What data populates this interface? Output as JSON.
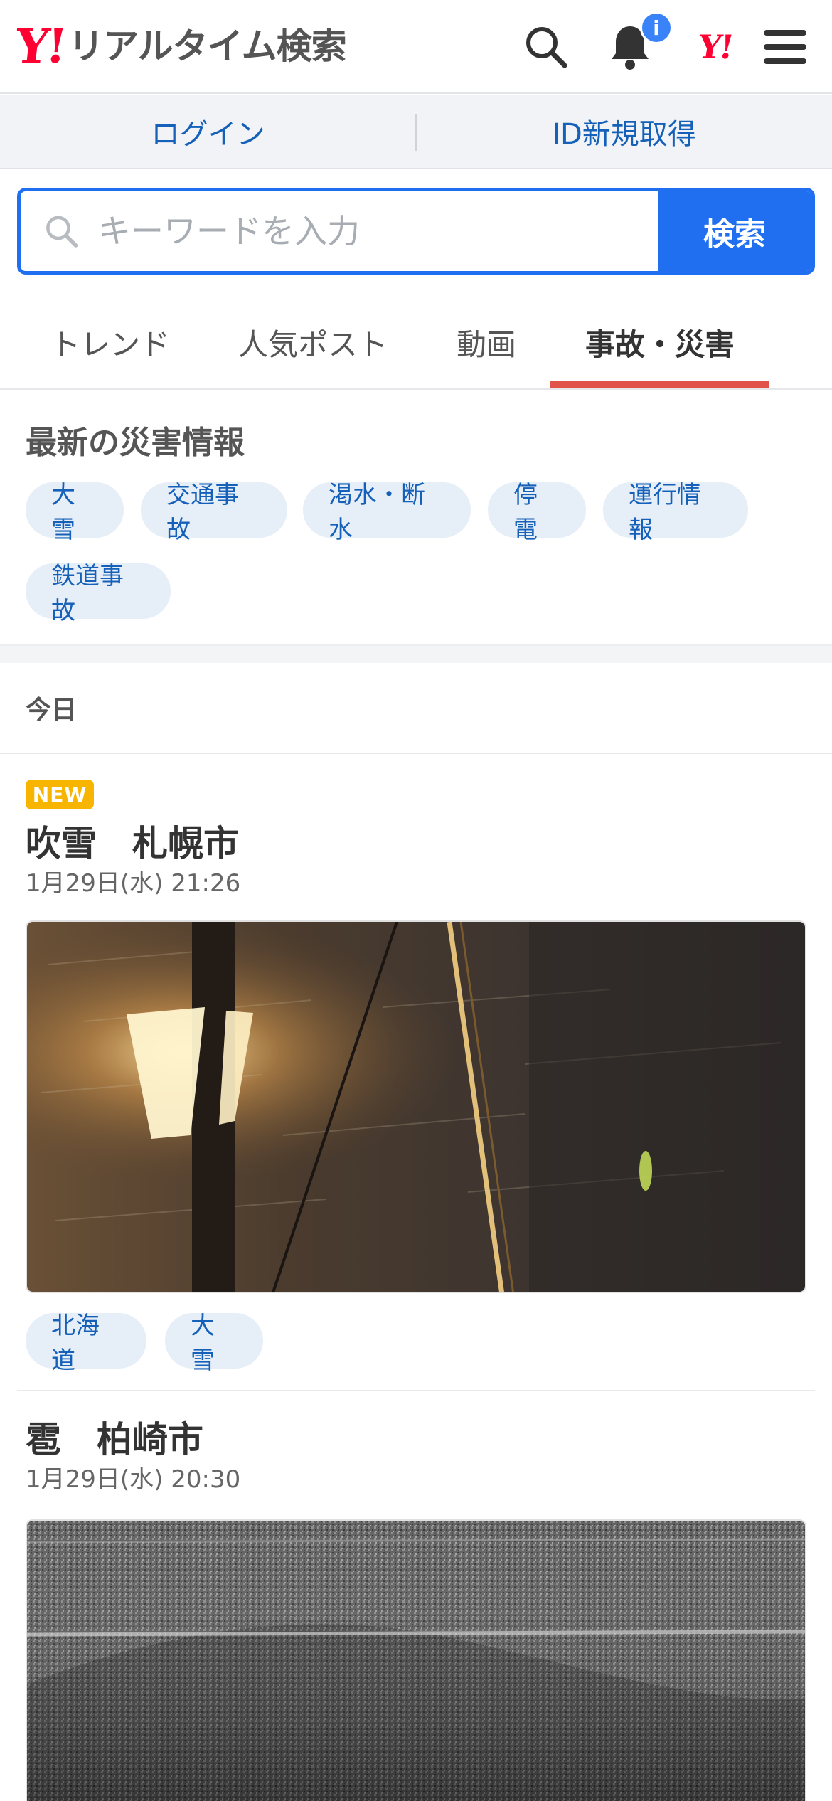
{
  "header": {
    "logo_mark": "Y!",
    "logo_text": "リアルタイム検索",
    "notification_badge": "i",
    "yahoo_link": "Y!"
  },
  "login_bar": {
    "login": "ログイン",
    "register": "ID新規取得"
  },
  "search": {
    "placeholder": "キーワードを入力",
    "button": "検索"
  },
  "tabs": [
    {
      "label": "トレンド",
      "active": false
    },
    {
      "label": "人気ポスト",
      "active": false
    },
    {
      "label": "動画",
      "active": false
    },
    {
      "label": "事故・災害",
      "active": true
    }
  ],
  "disaster": {
    "title": "最新の災害情報",
    "chips": [
      "大雪",
      "交通事故",
      "渇水・断水",
      "停電",
      "運行情報",
      "鉄道事故"
    ]
  },
  "today_label": "今日",
  "posts": [
    {
      "badge": "NEW",
      "title": "吹雪　札幌市",
      "time": "1月29日(水) 21:26",
      "tags": [
        "北海道",
        "大雪"
      ]
    },
    {
      "title": "雹　柏崎市",
      "time": "1月29日(水) 20:30"
    }
  ],
  "colors": {
    "brand_red": "#ff0033",
    "accent_blue": "#1f6ff0",
    "link_blue": "#1560b8",
    "tab_underline": "#e0524a",
    "new_badge": "#f7b500"
  }
}
